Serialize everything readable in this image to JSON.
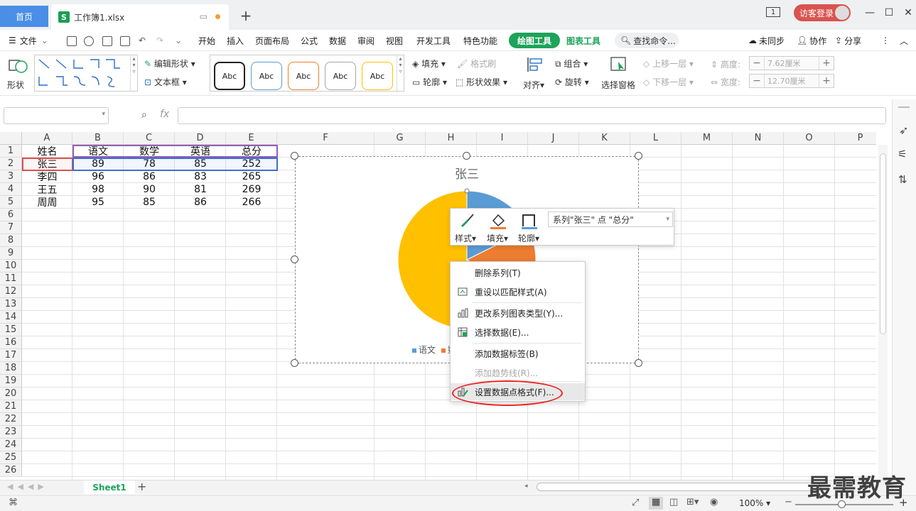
{
  "titlebar": {
    "home_tab": "首页",
    "file_tab": "工作簿1.xlsx",
    "file_icon_letter": "S",
    "badge": "1",
    "login": "访客登录",
    "minimize": "—",
    "maximize": "☐",
    "close": "✕"
  },
  "menubar": {
    "file": "文件",
    "items": [
      "开始",
      "插入",
      "页面布局",
      "公式",
      "数据",
      "审阅",
      "视图",
      "开发工具",
      "特色功能"
    ],
    "active_tab": "绘图工具",
    "chart_tab": "图表工具",
    "search": "查找命令...",
    "sync": "未同步",
    "collab": "协作",
    "share": "分享"
  },
  "ribbon": {
    "shape": "形状",
    "edit_shape": "编辑形状",
    "textbox": "文本框",
    "abc_styles": [
      "Abc",
      "Abc",
      "Abc",
      "Abc",
      "Abc"
    ],
    "abc_colors": [
      "#222222",
      "#5b9bd5",
      "#ed7d31",
      "#a5a5a5",
      "#ffc000"
    ],
    "fill": "填充",
    "outline": "轮廓",
    "format_brush": "格式刷",
    "shape_effect": "形状效果",
    "align": "对齐",
    "group": "组合",
    "rotate": "旋转",
    "select_pane": "选择窗格",
    "bring_up": "上移一层",
    "send_down": "下移一层",
    "height_label": "高度:",
    "height_value": "7.62厘米",
    "width_label": "宽度:",
    "width_value": "12.70厘米"
  },
  "formula": {
    "fx": "fx"
  },
  "grid": {
    "columns": [
      "A",
      "B",
      "C",
      "D",
      "E",
      "F",
      "G",
      "H",
      "I",
      "J",
      "K",
      "L",
      "M",
      "N",
      "O",
      "P"
    ],
    "rows": [
      "1",
      "2",
      "3",
      "4",
      "5",
      "6",
      "7",
      "8",
      "9",
      "10",
      "11",
      "12",
      "13",
      "14",
      "15",
      "16",
      "17",
      "18",
      "19",
      "20",
      "21",
      "22",
      "23",
      "24",
      "25",
      "26"
    ],
    "headers": [
      "姓名",
      "语文",
      "数学",
      "英语",
      "总分"
    ],
    "data": [
      [
        "张三",
        "89",
        "78",
        "85",
        "252"
      ],
      [
        "李四",
        "96",
        "86",
        "83",
        "265"
      ],
      [
        "王五",
        "98",
        "90",
        "81",
        "269"
      ],
      [
        "周周",
        "95",
        "85",
        "86",
        "266"
      ]
    ]
  },
  "chart": {
    "title": "张三",
    "legend": [
      "语文",
      "数"
    ],
    "colors": [
      "#5b9bd5",
      "#ed7d31",
      "#a5a5a5",
      "#ffc000"
    ]
  },
  "chart_data": {
    "type": "pie",
    "title": "张三",
    "categories": [
      "语文",
      "数学",
      "英语",
      "总分"
    ],
    "values": [
      89,
      78,
      85,
      252
    ]
  },
  "minibar": {
    "style": "样式",
    "fill": "填充",
    "outline": "轮廓",
    "series_selector": "系列\"张三\" 点 \"总分\""
  },
  "context_menu": {
    "items": [
      {
        "label": "删除系列(T)",
        "disabled": false
      },
      {
        "label": "重设以匹配样式(A)",
        "disabled": false
      },
      {
        "label": "更改系列图表类型(Y)...",
        "disabled": false
      },
      {
        "label": "选择数据(E)...",
        "disabled": false
      },
      {
        "label": "添加数据标签(B)",
        "disabled": false
      },
      {
        "label": "添加趋势线(R)...",
        "disabled": true
      },
      {
        "label": "设置数据点格式(F)...",
        "disabled": false
      }
    ]
  },
  "sheets": {
    "active": "Sheet1",
    "add": "+"
  },
  "status": {
    "zoom": "100%"
  },
  "watermark": "最需教育"
}
